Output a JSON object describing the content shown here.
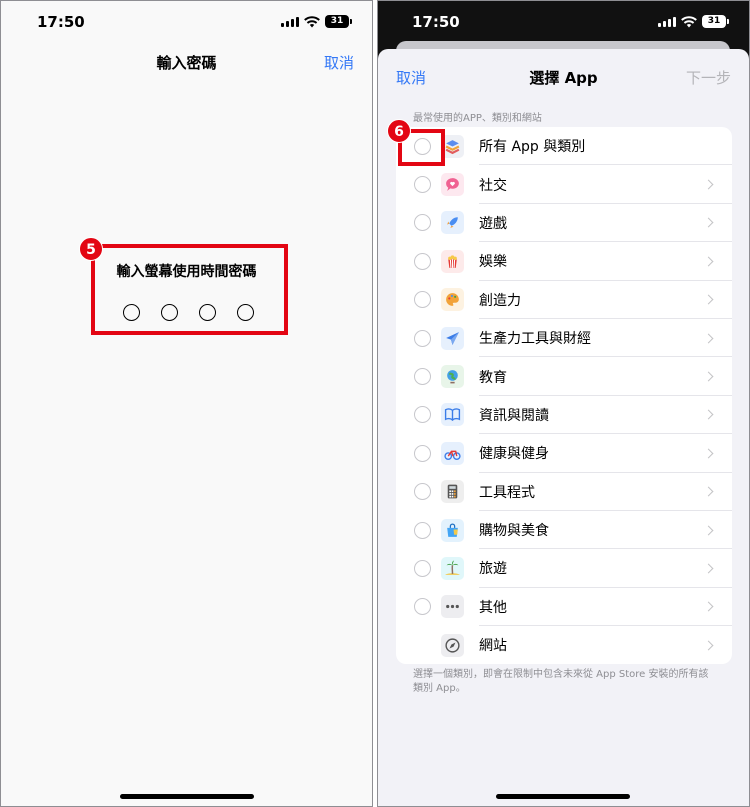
{
  "left": {
    "status": {
      "time": "17:50",
      "battery": "31"
    },
    "nav": {
      "title": "輸入密碼",
      "cancel": "取消"
    },
    "badge": "5",
    "passcode": {
      "label": "輸入螢幕使用時間密碼",
      "digits": 4
    }
  },
  "right": {
    "status": {
      "time": "17:50",
      "battery": "31"
    },
    "nav": {
      "cancel": "取消",
      "title": "選擇 App",
      "next": "下一步"
    },
    "section_header": "最常使用的APP、類別和網站",
    "badge": "6",
    "items": [
      {
        "label": "所有 App 與類別",
        "icon": "layers-icon",
        "chevron": false,
        "radio": true
      },
      {
        "label": "社交",
        "icon": "heart-bubble-icon",
        "chevron": true,
        "radio": true
      },
      {
        "label": "遊戲",
        "icon": "rocket-icon",
        "chevron": true,
        "radio": true
      },
      {
        "label": "娛樂",
        "icon": "popcorn-icon",
        "chevron": true,
        "radio": true
      },
      {
        "label": "創造力",
        "icon": "palette-icon",
        "chevron": true,
        "radio": true
      },
      {
        "label": "生產力工具與財經",
        "icon": "paper-plane-icon",
        "chevron": true,
        "radio": true
      },
      {
        "label": "教育",
        "icon": "globe-icon",
        "chevron": true,
        "radio": true
      },
      {
        "label": "資訊與閱讀",
        "icon": "book-icon",
        "chevron": true,
        "radio": true
      },
      {
        "label": "健康與健身",
        "icon": "bicycle-icon",
        "chevron": true,
        "radio": true
      },
      {
        "label": "工具程式",
        "icon": "calculator-icon",
        "chevron": true,
        "radio": true
      },
      {
        "label": "購物與美食",
        "icon": "shopping-bag-icon",
        "chevron": true,
        "radio": true
      },
      {
        "label": "旅遊",
        "icon": "palm-tree-icon",
        "chevron": true,
        "radio": true
      },
      {
        "label": "其他",
        "icon": "ellipsis-icon",
        "chevron": true,
        "radio": true
      },
      {
        "label": "網站",
        "icon": "compass-icon",
        "chevron": true,
        "radio": false
      }
    ],
    "footer": "選擇一個類別，即會在限制中包含未來從 App Store 安裝的所有該類別 App。"
  },
  "colors": {
    "accent": "#3478f6",
    "highlight": "#e30613"
  }
}
